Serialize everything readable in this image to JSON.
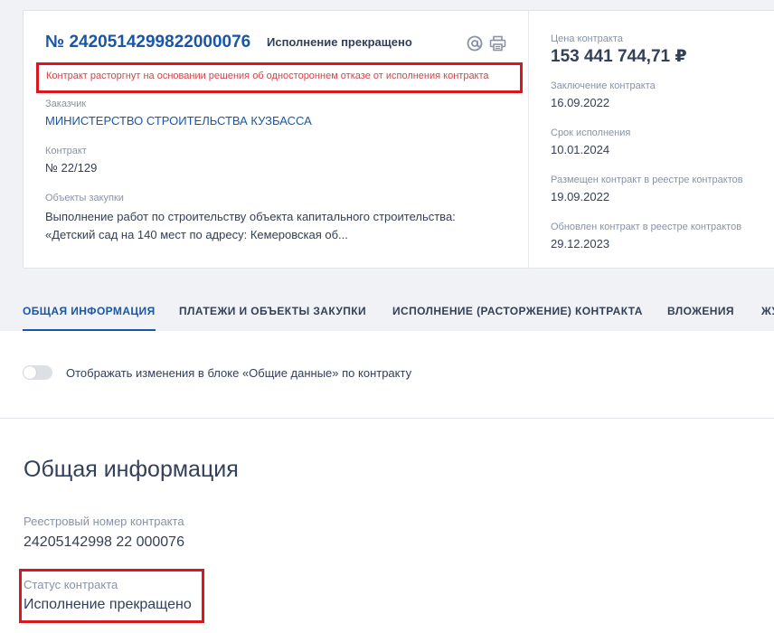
{
  "header": {
    "contract_number": "№ 2420514299822000076",
    "status": "Исполнение прекращено",
    "warning": "Контракт расторгнут на основании решения об одностороннем отказе от исполнения контракта"
  },
  "details": {
    "customer_label": "Заказчик",
    "customer_value": "МИНИСТЕРСТВО СТРОИТЕЛЬСТВА КУЗБАССА",
    "contract_label": "Контракт",
    "contract_value": "№ 22/129",
    "objects_label": "Объекты закупки",
    "objects_value": "Выполнение работ по строительству объекта капитального строительства: «Детский сад на 140 мест по адресу: Кемеровская об..."
  },
  "summary": {
    "price_label": "Цена контракта",
    "price_value": "153 441 744,71 ₽",
    "conclusion_label": "Заключение контракта",
    "conclusion_value": "16.09.2022",
    "deadline_label": "Срок исполнения",
    "deadline_value": "10.01.2024",
    "placed_label": "Размещен контракт в реестре контрактов",
    "placed_value": "19.09.2022",
    "updated_label": "Обновлен контракт в реестре контрактов",
    "updated_value": "29.12.2023"
  },
  "tabs": [
    {
      "label": "ОБЩАЯ ИНФОРМАЦИЯ",
      "active": true
    },
    {
      "label": "ПЛАТЕЖИ И ОБЪЕКТЫ ЗАКУПКИ",
      "active": false
    },
    {
      "label": "ИСПОЛНЕНИЕ (РАСТОРЖЕНИЕ) КОНТРАКТА",
      "active": false
    },
    {
      "label": "ВЛОЖЕНИЯ",
      "active": false
    },
    {
      "label": "ЖУ",
      "active": false
    }
  ],
  "toggle": {
    "label": "Отображать изменения в блоке «Общие данные» по контракту",
    "on": false
  },
  "general": {
    "title": "Общая информация",
    "reg_label": "Реестровый номер контракта",
    "reg_value": "24205142998 22 000076",
    "status_label": "Статус контракта",
    "status_value": "Исполнение прекращено"
  },
  "icons": {
    "email": "at-icon",
    "print": "printer-icon"
  },
  "colors": {
    "accent": "#1a56a8",
    "warning": "#d4434a",
    "highlight_border": "#d8181e"
  }
}
